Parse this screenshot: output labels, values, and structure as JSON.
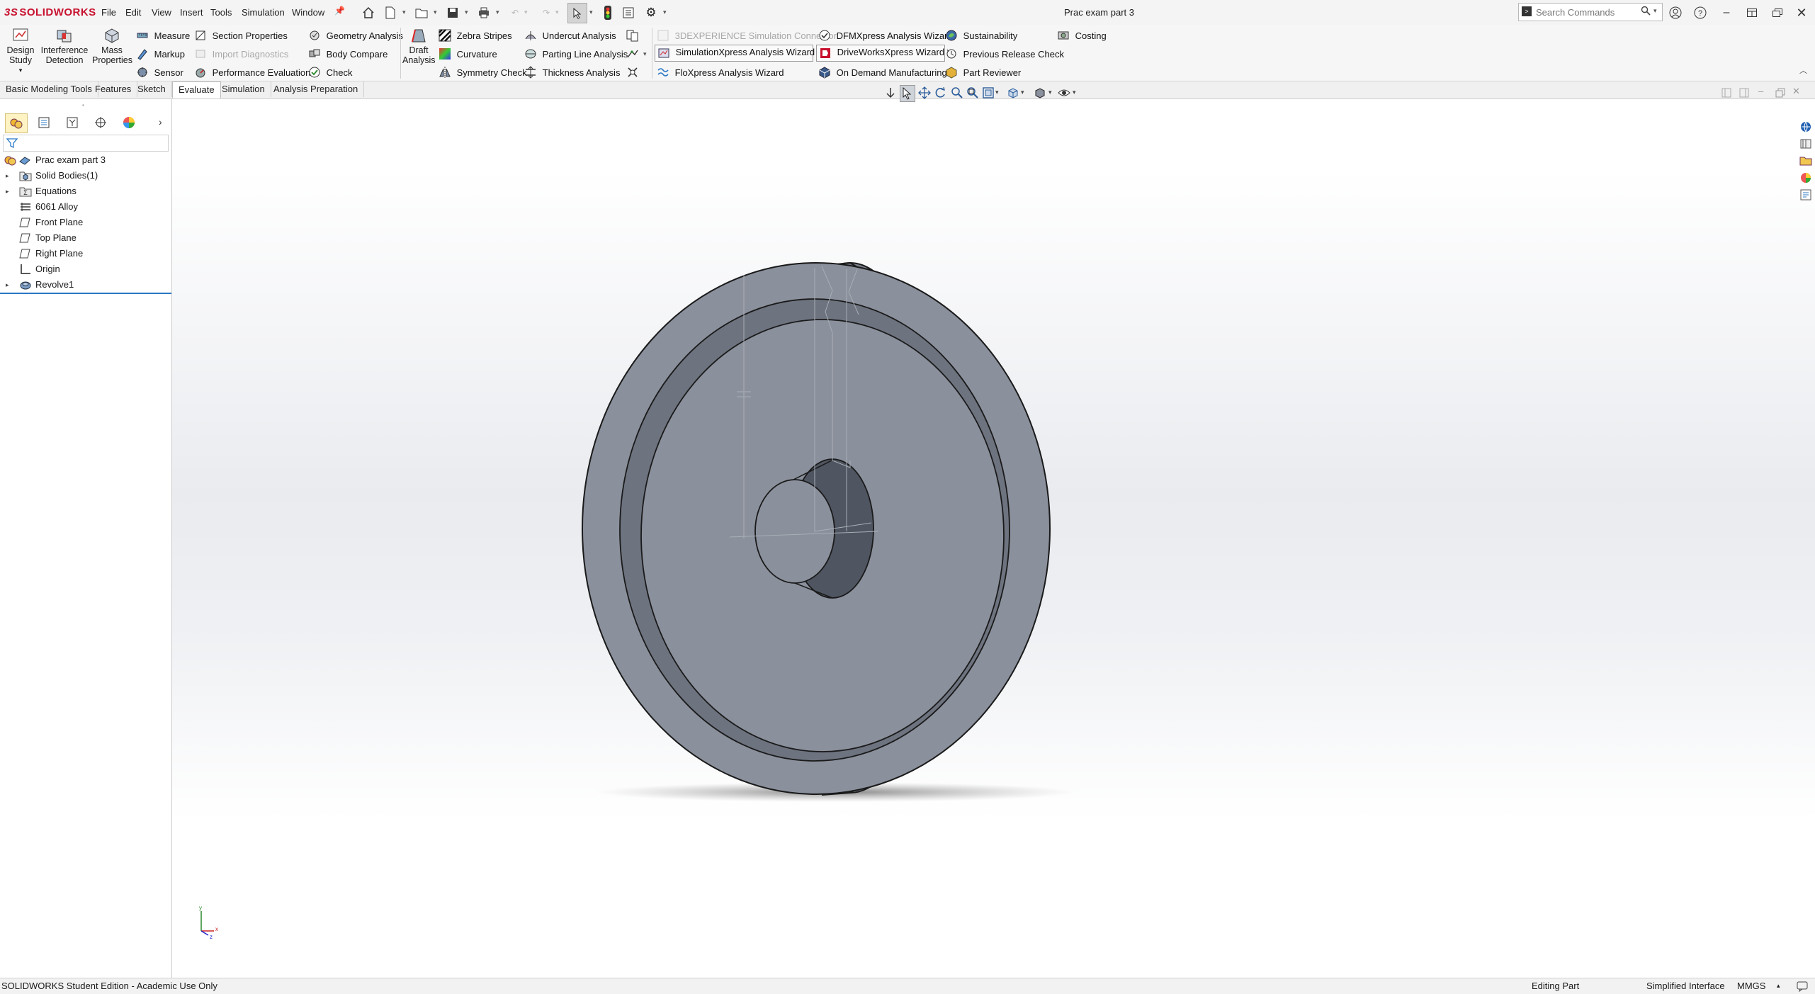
{
  "app": {
    "logo": "SOLIDWORKS",
    "logo_prefix": "3S",
    "document_title": "Prac exam part 3"
  },
  "menus": [
    "File",
    "Edit",
    "View",
    "Insert",
    "Tools",
    "Simulation",
    "Window"
  ],
  "search": {
    "placeholder": "Search Commands"
  },
  "ribbon": {
    "design_study": [
      "Design",
      "Study"
    ],
    "interference_detection": [
      "Interference",
      "Detection"
    ],
    "mass_properties": [
      "Mass",
      "Properties"
    ],
    "draft_analysis": [
      "Draft",
      "Analysis"
    ],
    "measure": "Measure",
    "markup": "Markup",
    "sensor": "Sensor",
    "section_properties": "Section Properties",
    "import_diagnostics": "Import Diagnostics",
    "performance_evaluation": "Performance Evaluation",
    "geometry_analysis": "Geometry Analysis",
    "body_compare": "Body Compare",
    "check": "Check",
    "zebra_stripes": "Zebra Stripes",
    "curvature": "Curvature",
    "symmetry_check": "Symmetry Check",
    "undercut_analysis": "Undercut Analysis",
    "parting_line_analysis": "Parting Line Analysis",
    "thickness_analysis": "Thickness Analysis",
    "experience_connector": "3DEXPERIENCE Simulation Connector",
    "simulationxpress": "SimulationXpress Analysis Wizard",
    "floxpress": "FloXpress Analysis Wizard",
    "dfmxpress": "DFMXpress Analysis Wizard",
    "driveworksxpress": "DriveWorksXpress Wizard",
    "on_demand": "On Demand Manufacturing",
    "sustainability": "Sustainability",
    "previous_release_check": "Previous Release Check",
    "part_reviewer": "Part Reviewer",
    "costing": "Costing"
  },
  "tabs": [
    "Basic Modeling Tools",
    "Features",
    "Sketch",
    "Evaluate",
    "Simulation",
    "Analysis Preparation"
  ],
  "active_tab": "Evaluate",
  "tree": {
    "root": "Prac exam part 3",
    "items": [
      "Solid Bodies(1)",
      "Equations",
      "6061 Alloy",
      "Front Plane",
      "Top Plane",
      "Right Plane",
      "Origin",
      "Revolve1"
    ]
  },
  "triad": {
    "x": "x",
    "y": "y",
    "z": "z"
  },
  "status": {
    "edition": "SOLIDWORKS Student Edition - Academic Use Only",
    "mode": "Editing Part",
    "interface": "Simplified Interface",
    "units": "MMGS"
  },
  "colors": {
    "brand": "#c8102e",
    "part_face": "#8a909c",
    "part_dark": "#5f6571",
    "accent": "#2b78c5"
  }
}
